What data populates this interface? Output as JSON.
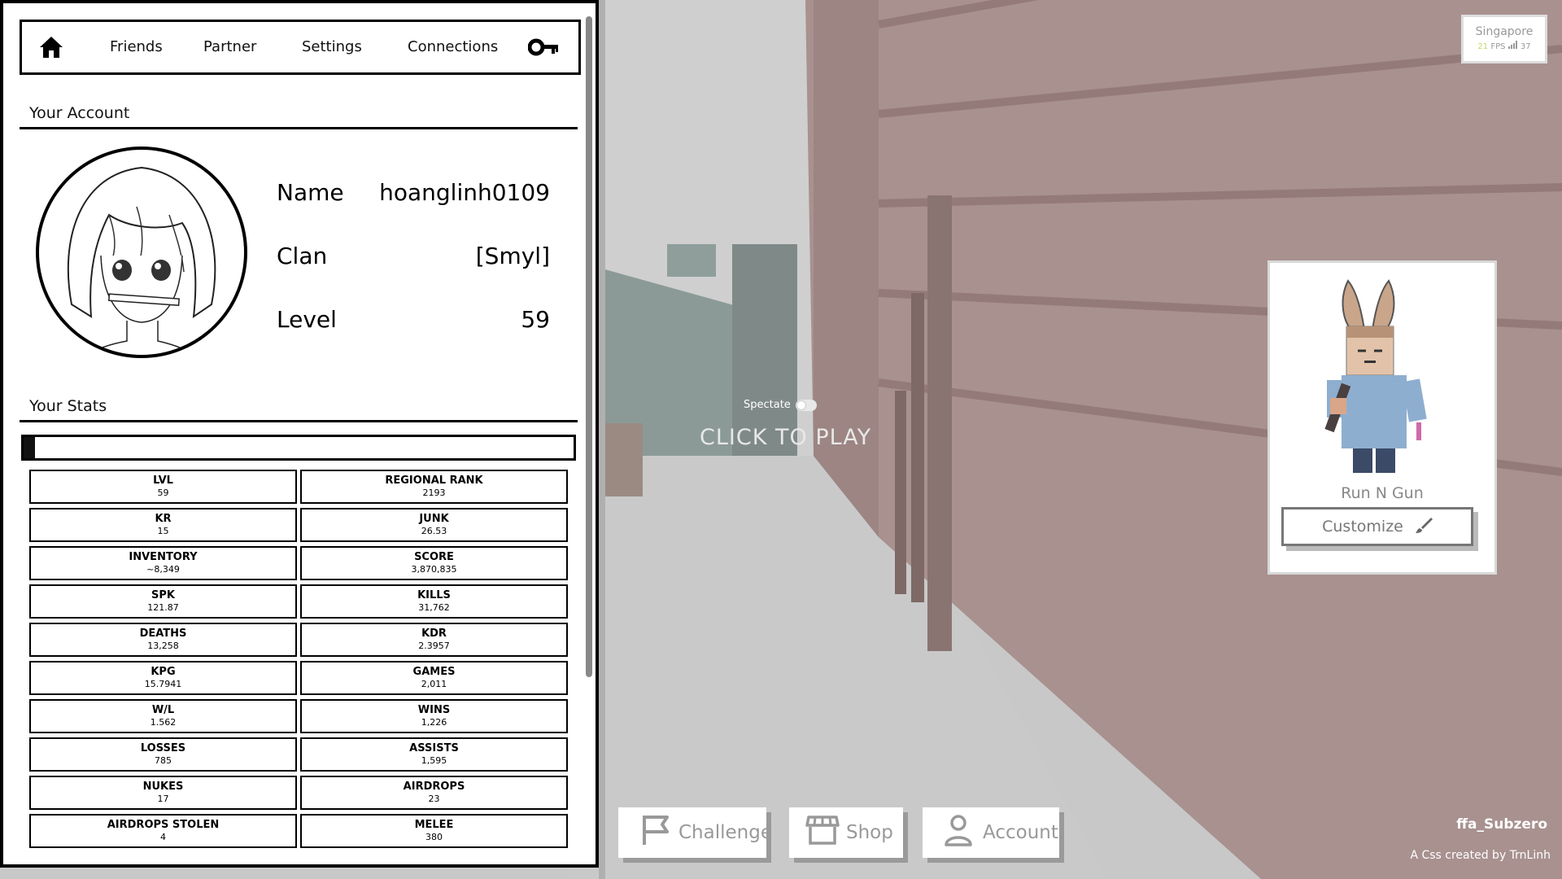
{
  "nav": {
    "items": [
      "Friends",
      "Partner",
      "Settings",
      "Connections"
    ]
  },
  "account": {
    "section_title": "Your Account",
    "name_label": "Name",
    "name_value": "hoanglinh0109",
    "clan_label": "Clan",
    "clan_value": "[Smyl]",
    "level_label": "Level",
    "level_value": "59"
  },
  "stats": {
    "section_title": "Your Stats",
    "level_progress": 0.02,
    "items": [
      {
        "k": "LVL",
        "v": "59"
      },
      {
        "k": "REGIONAL RANK",
        "v": "2193"
      },
      {
        "k": "KR",
        "v": "15"
      },
      {
        "k": "JUNK",
        "v": "26.53"
      },
      {
        "k": "INVENTORY",
        "v": "~8,349"
      },
      {
        "k": "SCORE",
        "v": "3,870,835"
      },
      {
        "k": "SPK",
        "v": "121.87"
      },
      {
        "k": "KILLS",
        "v": "31,762"
      },
      {
        "k": "DEATHS",
        "v": "13,258"
      },
      {
        "k": "KDR",
        "v": "2.3957"
      },
      {
        "k": "KPG",
        "v": "15.7941"
      },
      {
        "k": "GAMES",
        "v": "2,011"
      },
      {
        "k": "W/L",
        "v": "1.562"
      },
      {
        "k": "WINS",
        "v": "1,226"
      },
      {
        "k": "LOSSES",
        "v": "785"
      },
      {
        "k": "ASSISTS",
        "v": "1,595"
      },
      {
        "k": "NUKES",
        "v": "17"
      },
      {
        "k": "AIRDROPS",
        "v": "23"
      },
      {
        "k": "AIRDROPS STOLEN",
        "v": "4"
      },
      {
        "k": "MELEE",
        "v": "380"
      }
    ]
  },
  "server": {
    "region": "Singapore",
    "fps": "21",
    "fps_label": "FPS",
    "ping": "37"
  },
  "play": {
    "spectate_label": "Spectate",
    "click_to_play": "CLICK TO PLAY"
  },
  "character": {
    "class_name": "Run N Gun",
    "customize_label": "Customize"
  },
  "bottom": {
    "challenge": "Challenge",
    "shop": "Shop",
    "account": "Account"
  },
  "map_name": "ffa_Subzero",
  "credit": "A Css created by TrnLinh",
  "colors": {
    "panel_bg": "#ffffff",
    "panel_border": "#000000",
    "overlay_text": "#999999",
    "fps_color": "#c9d36a"
  }
}
